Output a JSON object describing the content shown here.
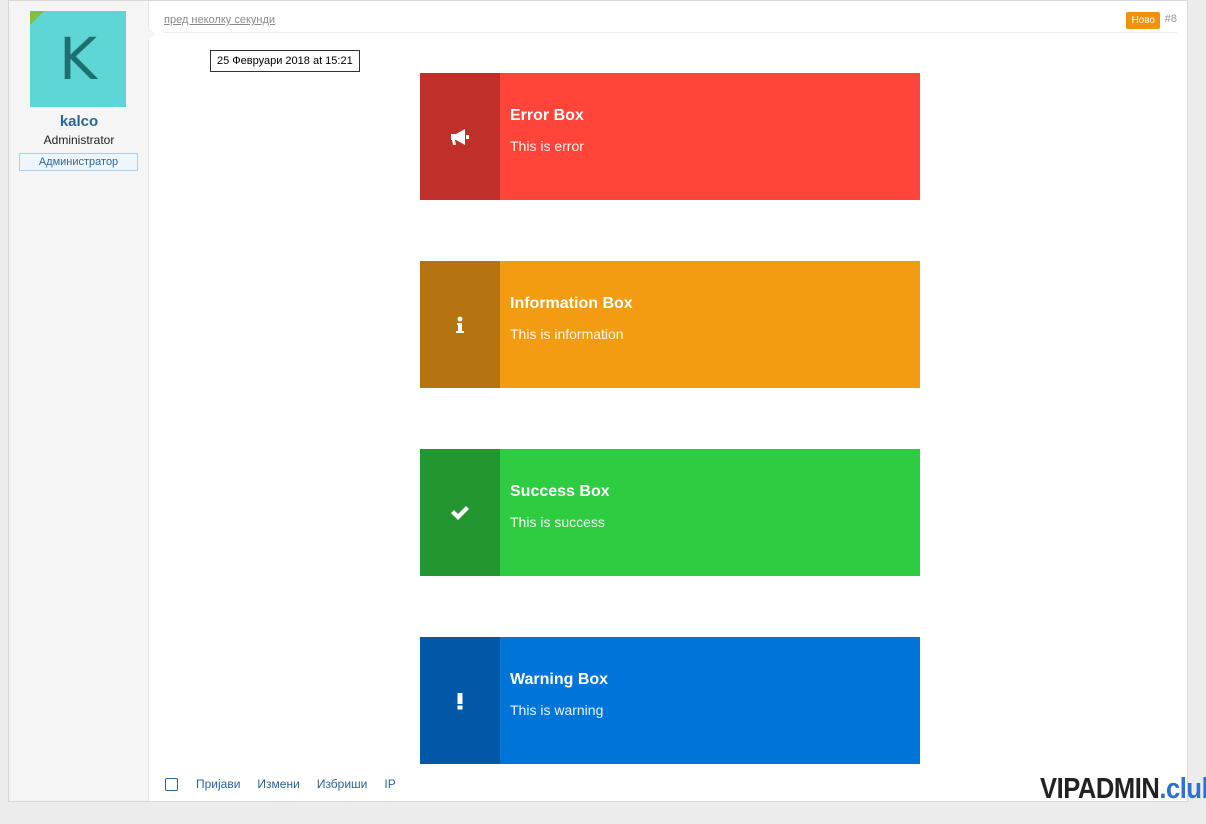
{
  "user": {
    "avatar_letter": "K",
    "username": "kalco",
    "title": "Administrator",
    "banner": "Администратор"
  },
  "post": {
    "time_ago": "пред неколку секунди",
    "tooltip_date": "25 Февруари 2018 at 15:21",
    "new_badge": "Ново",
    "number": "#8"
  },
  "alerts": [
    {
      "title": "Error Box",
      "text": "This is error",
      "icon": "megaphone-icon",
      "color": "#ff443a",
      "icon_bg": "#c02f2a"
    },
    {
      "title": "Information Box",
      "text": "This is information",
      "icon": "info-icon",
      "color": "#f39c12",
      "icon_bg": "#b57410"
    },
    {
      "title": "Success Box",
      "text": "This is success",
      "icon": "check-icon",
      "color": "#2ecc40",
      "icon_bg": "#24962f"
    },
    {
      "title": "Warning Box",
      "text": "This is warning",
      "icon": "exclamation-icon",
      "color": "#0074d9",
      "icon_bg": "#0058a6"
    }
  ],
  "footer": {
    "report": "Пријави",
    "edit": "Измени",
    "delete": "Избриши",
    "ip": "IP"
  },
  "watermark": {
    "part1": "VIPADMIN",
    "part2": ".club"
  }
}
